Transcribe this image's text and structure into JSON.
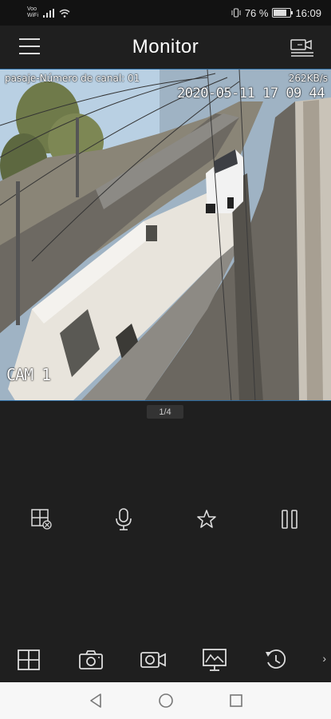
{
  "status_bar": {
    "carrier_top": "Voo",
    "carrier_bottom": "WiFi",
    "battery_text": "76 %",
    "time": "16:09",
    "battery_level": 0.76
  },
  "header": {
    "title": "Monitor",
    "menu_icon": "hamburger-menu-icon",
    "right_icon": "camera-list-icon"
  },
  "video": {
    "channel_label": "pasaje-Número de canal: 01",
    "bitrate": "262KB/s",
    "timestamp": "2020-05-11 17 09 44",
    "camera_name": "CAM 1"
  },
  "pager": {
    "text": "1/4"
  },
  "controls": [
    {
      "icon": "close-window-icon",
      "name": "close-channel"
    },
    {
      "icon": "microphone-icon",
      "name": "talk"
    },
    {
      "icon": "star-icon",
      "name": "favorite"
    },
    {
      "icon": "pause-icon",
      "name": "pause"
    }
  ],
  "toolbar": [
    {
      "icon": "grid-layout-icon",
      "name": "layout"
    },
    {
      "icon": "snapshot-camera-icon",
      "name": "snapshot"
    },
    {
      "icon": "record-video-icon",
      "name": "record"
    },
    {
      "icon": "image-quality-icon",
      "name": "quality"
    },
    {
      "icon": "playback-icon",
      "name": "playback"
    }
  ],
  "toolbar_more": "›"
}
